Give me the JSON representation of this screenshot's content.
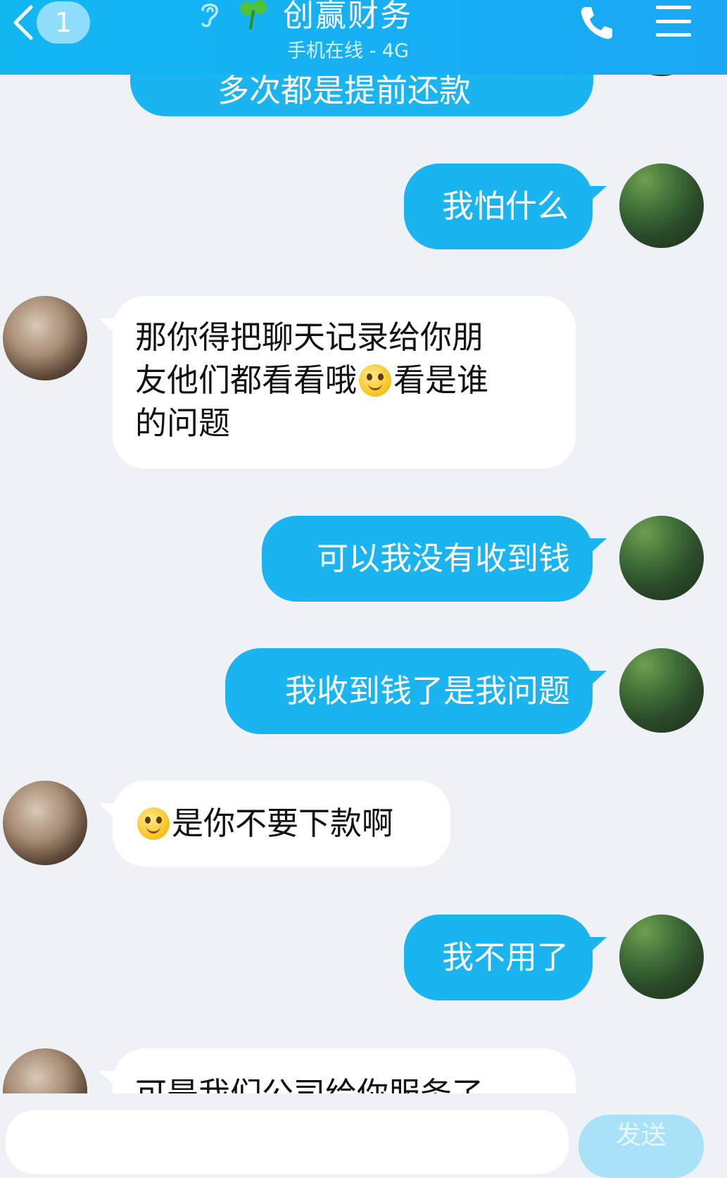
{
  "header": {
    "unread_count": "1",
    "contact_name": "创赢财务",
    "status": "手机在线 - 4G"
  },
  "messages": [
    {
      "side": "right",
      "text": "多次都是提前还款"
    },
    {
      "side": "right",
      "text": "我怕什么"
    },
    {
      "side": "left",
      "line1": "那你得把聊天记录给你朋",
      "line2a": "友他们都看看哦",
      "line2b": "看是谁",
      "line3": "的问题"
    },
    {
      "side": "right",
      "text": "可以我没有收到钱"
    },
    {
      "side": "right",
      "text": "我收到钱了是我问题"
    },
    {
      "side": "left",
      "text": "是你不要下款啊"
    },
    {
      "side": "right",
      "text": "我不用了"
    },
    {
      "side": "left",
      "text": "可是我们公司给你服务了"
    }
  ],
  "input": {
    "send_label": "发送"
  },
  "colors": {
    "header_bg": "#12b7f2",
    "outgoing_bubble": "#1ab4f1",
    "incoming_bubble": "#ffffff",
    "chat_bg": "#eef1f6"
  }
}
